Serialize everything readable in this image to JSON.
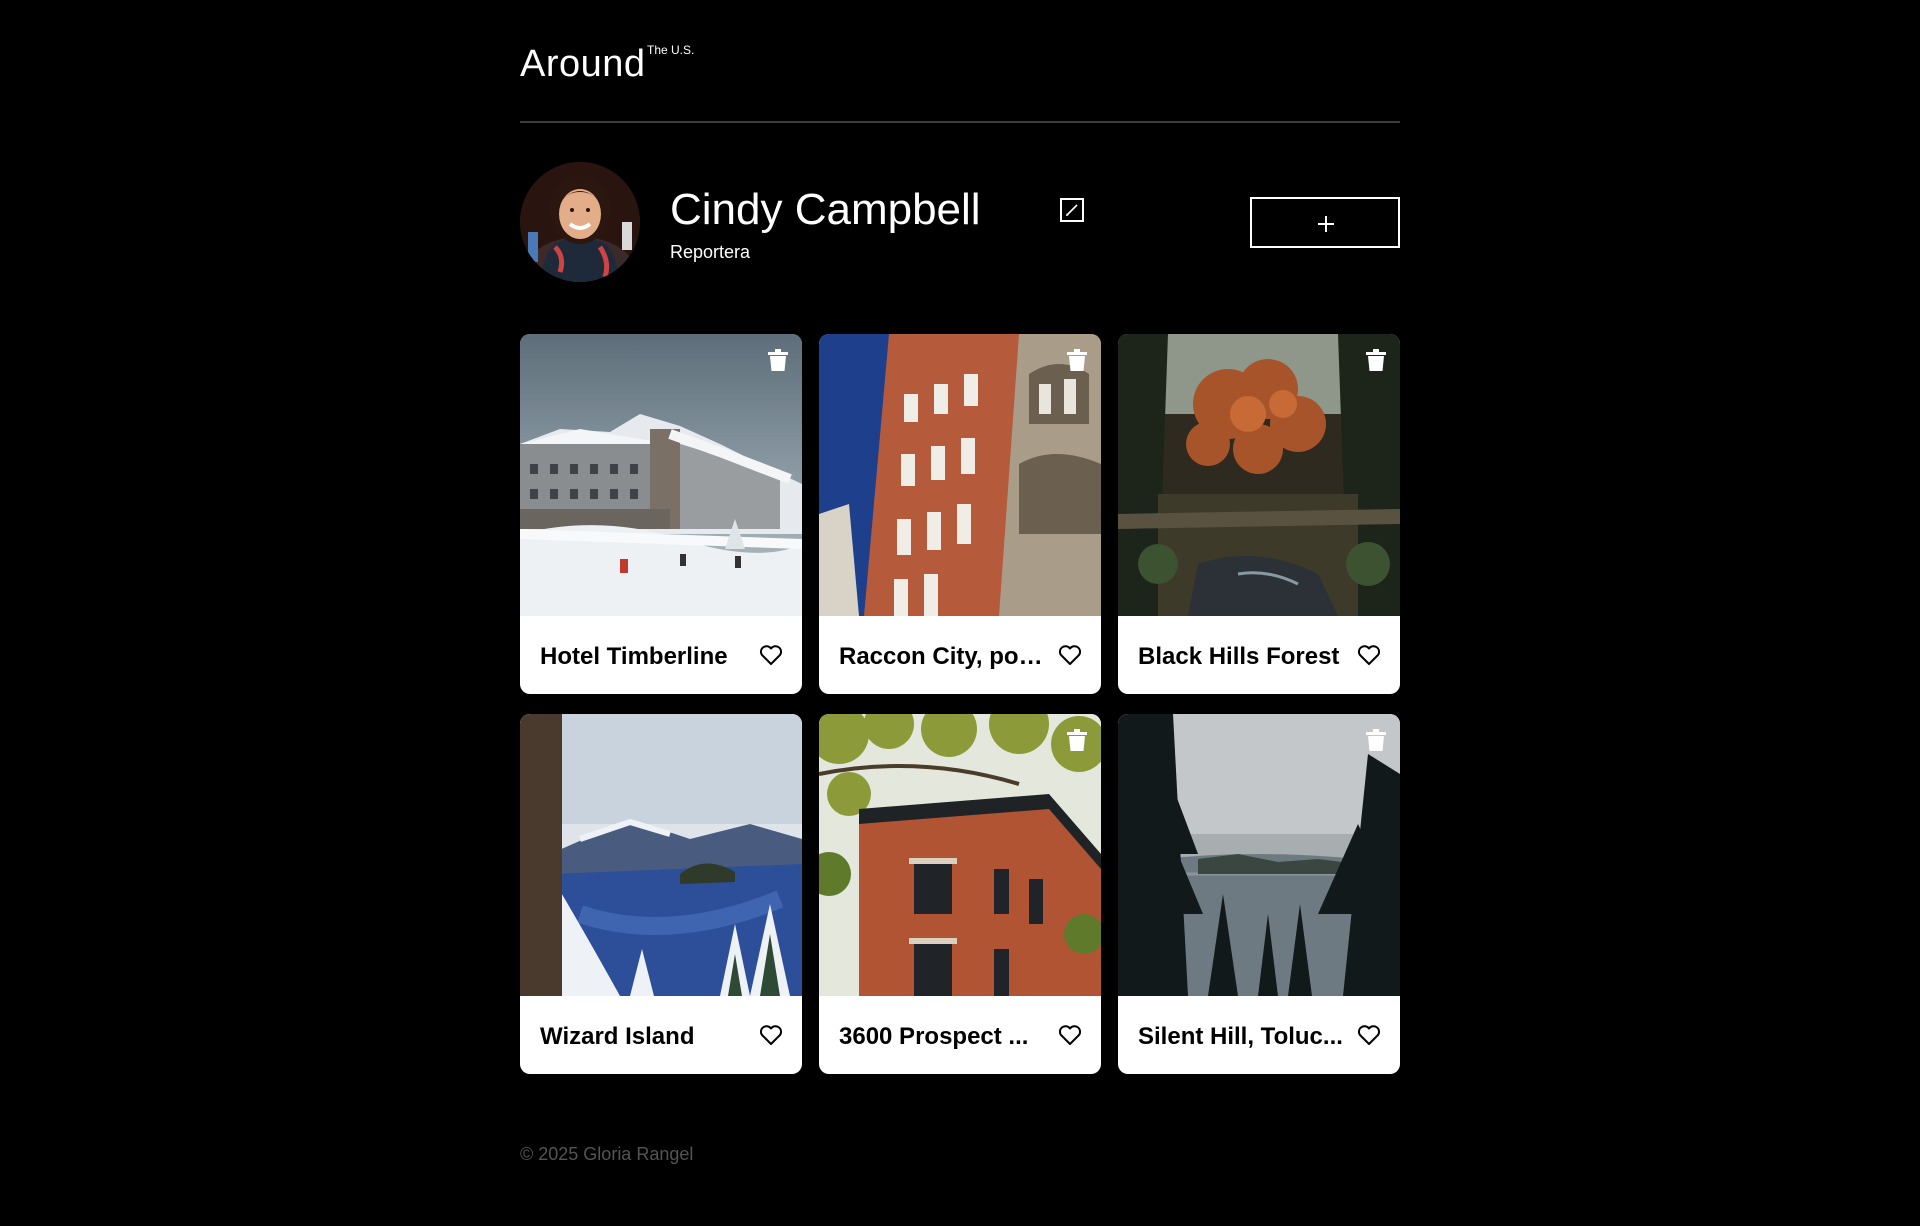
{
  "header": {
    "logo": "Around",
    "logo_sup": "The U.S."
  },
  "profile": {
    "name": "Cindy Campbell",
    "job": "Reportera",
    "edit_icon": "edit-icon",
    "add_icon": "plus-icon"
  },
  "cards": [
    {
      "title": "Hotel Timberline",
      "image": "snowy-lodge"
    },
    {
      "title": "Raccon City, pol...",
      "image": "brick-building"
    },
    {
      "title": "Black Hills Forest",
      "image": "autumn-forest"
    },
    {
      "title": "Wizard Island",
      "image": "crater-lake"
    },
    {
      "title": "3600 Prospect ...",
      "image": "brick-house"
    },
    {
      "title": "Silent Hill, Toluc...",
      "image": "misty-lake"
    }
  ],
  "footer": {
    "copyright": "© 2025 Gloria Rangel"
  },
  "colors": {
    "background": "#000000",
    "card": "#ffffff",
    "divider": "#3d3d3d",
    "footer_text": "#545454"
  }
}
